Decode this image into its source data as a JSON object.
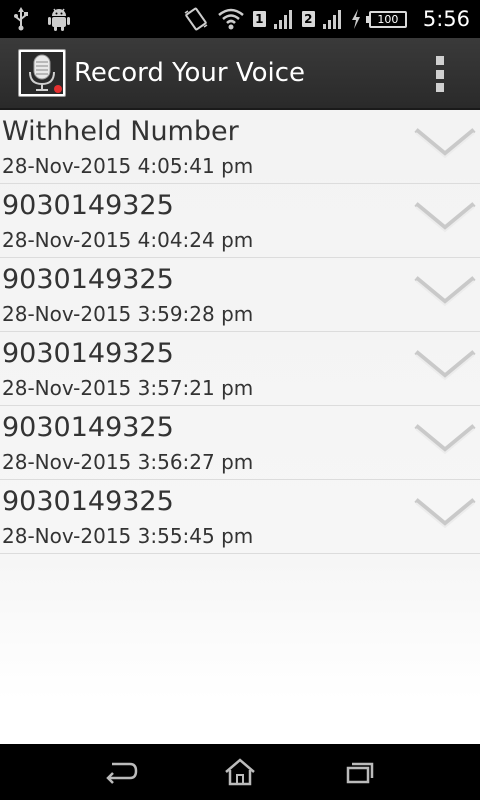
{
  "status_bar": {
    "time": "5:56",
    "battery_level": "100",
    "sim1_label": "1",
    "sim2_label": "2",
    "icons": [
      "usb-icon",
      "android-icon",
      "vibrate-icon",
      "wifi-icon",
      "signal-icon",
      "charging-icon",
      "battery-icon"
    ]
  },
  "action_bar": {
    "title": "Record Your Voice",
    "app_icon": "microphone-record-icon",
    "overflow_icon": "overflow-menu-icon"
  },
  "recordings": [
    {
      "title": "Withheld Number",
      "datetime": "28-Nov-2015 4:05:41 pm"
    },
    {
      "title": "9030149325",
      "datetime": "28-Nov-2015 4:04:24 pm"
    },
    {
      "title": "9030149325",
      "datetime": "28-Nov-2015 3:59:28 pm"
    },
    {
      "title": "9030149325",
      "datetime": "28-Nov-2015 3:57:21 pm"
    },
    {
      "title": "9030149325",
      "datetime": "28-Nov-2015 3:56:27 pm"
    },
    {
      "title": "9030149325",
      "datetime": "28-Nov-2015 3:55:45 pm"
    }
  ],
  "nav_bar": {
    "icons": [
      "back-icon",
      "home-icon",
      "recent-apps-icon"
    ]
  },
  "colors": {
    "action_bar": "#2f2f2f",
    "status_bar": "#000000",
    "list_background": "#f2f2f2",
    "text": "#333333",
    "record_dot": "#e53030"
  }
}
